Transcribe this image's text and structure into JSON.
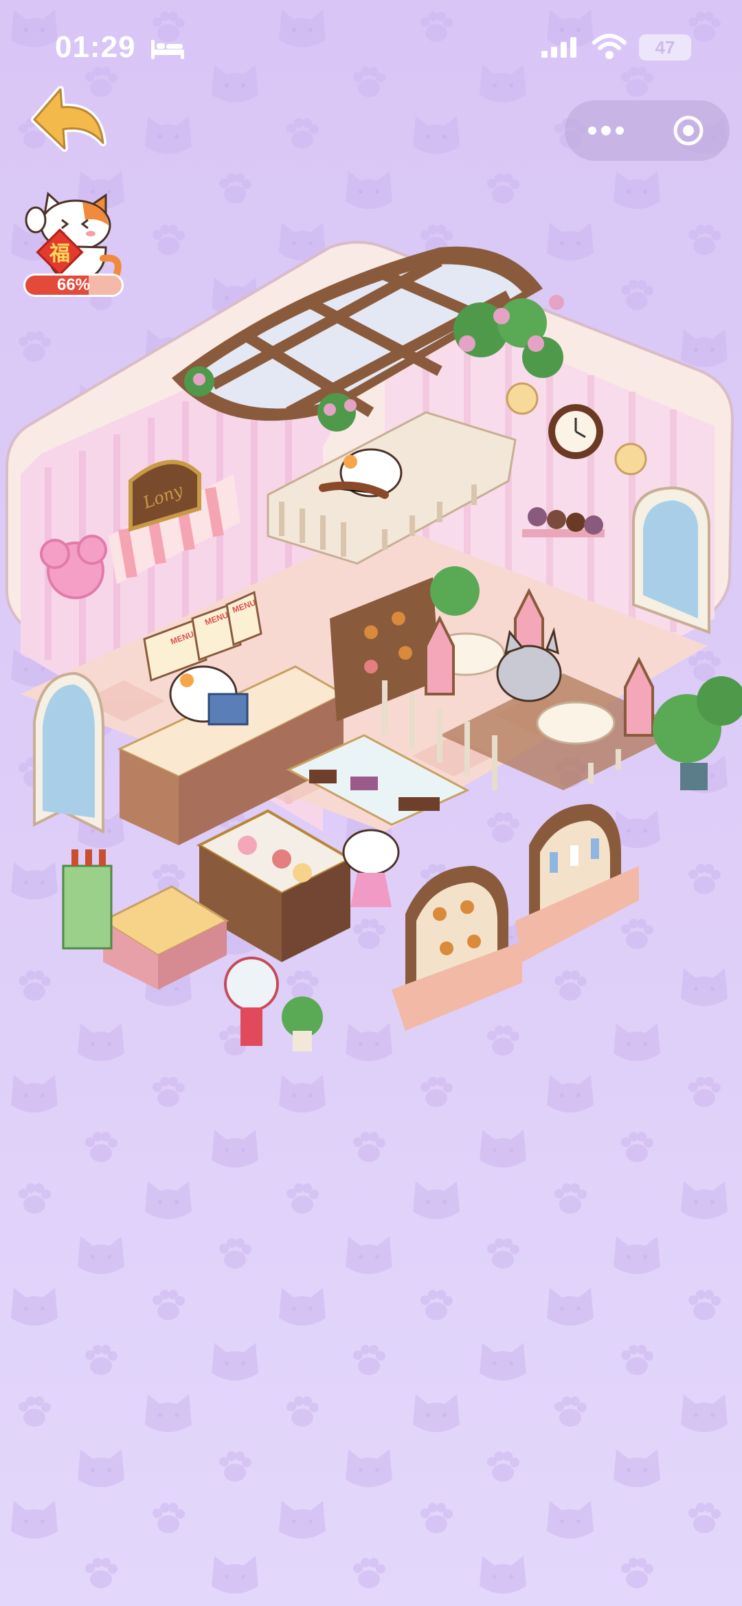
{
  "status_bar": {
    "time": "01:29",
    "battery": "47",
    "icons": [
      "bed-icon",
      "signal-icon",
      "wifi-icon",
      "battery-icon"
    ]
  },
  "navigation": {
    "back_icon": "back-arrow-icon",
    "menu_capsule_icons": [
      "more-dots-icon",
      "target-close-icon"
    ]
  },
  "fortune": {
    "character": "福",
    "percent_label": "66%",
    "progress": 0.66
  },
  "scene": {
    "sign_text": "Lony",
    "menu_board": [
      "MENU",
      "MENU",
      "MENU"
    ]
  },
  "colors": {
    "background": "#dccbf7",
    "room_wall": "#f6d3ea",
    "wood": "#8a5a3c",
    "accent_red": "#e34a3a",
    "floor": "#f7d9d2"
  }
}
